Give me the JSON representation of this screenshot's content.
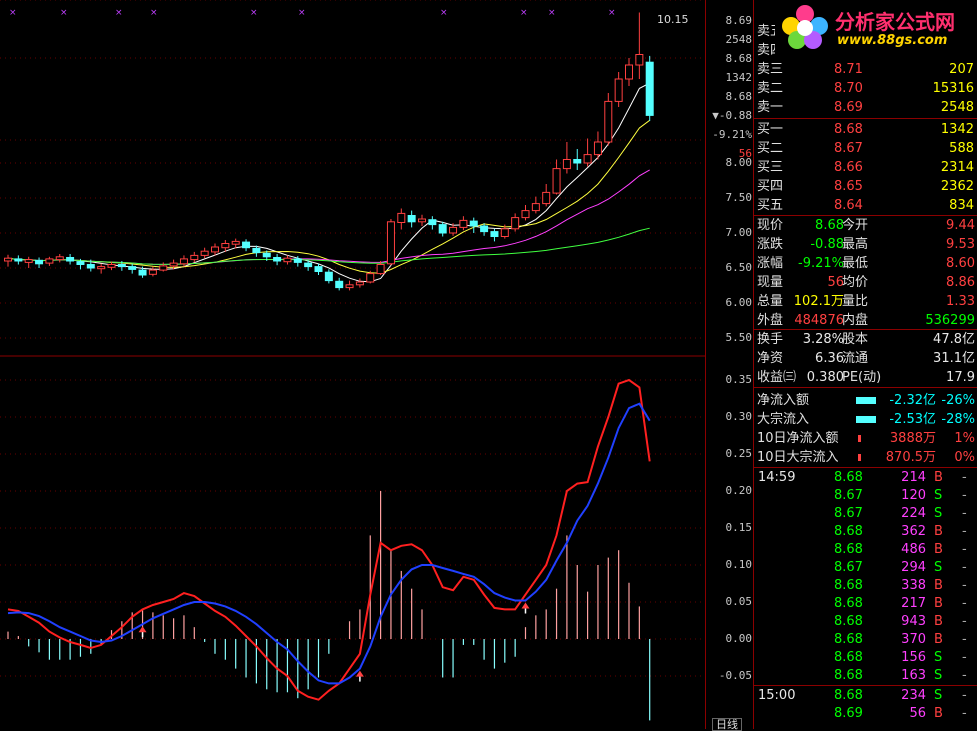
{
  "colors": {
    "up": "#ff4040",
    "down": "#54ffff",
    "ma5": "#ffffff",
    "ma10": "#ffff40",
    "ma20": "#ff40ff",
    "ma60": "#40ff40",
    "dif": "#ff2020",
    "dea": "#2040ff"
  },
  "logo": {
    "text": "分析家公式网",
    "url": "www.88gs.com"
  },
  "price_axis": {
    "top": [
      {
        "v": "8.69",
        "cls": "w"
      },
      {
        "v": "2548",
        "cls": "w"
      },
      {
        "v": "8.68",
        "cls": "w"
      },
      {
        "v": "1342",
        "cls": "w"
      },
      {
        "v": "8.68",
        "cls": "w"
      },
      {
        "v": "▼-0.88",
        "cls": "w"
      },
      {
        "v": "-9.21%",
        "cls": "w"
      },
      {
        "v": "56",
        "cls": "r"
      }
    ],
    "ticks": [
      "8.00",
      "7.50",
      "7.00",
      "6.50",
      "6.00",
      "5.50"
    ]
  },
  "macd_axis": {
    "ticks": [
      "0.35",
      "0.30",
      "0.25",
      "0.20",
      "0.15",
      "0.10",
      "0.05",
      "0.00",
      "-0.05"
    ]
  },
  "chart_labels": {
    "high_mark": "10.15",
    "bottom_right": "日线"
  },
  "order_book": {
    "sell": [
      {
        "label": "卖五",
        "price": "",
        "vol": ""
      },
      {
        "label": "卖四",
        "price": "",
        "vol": ""
      },
      {
        "label": "卖三",
        "price": "8.71",
        "vol": "207"
      },
      {
        "label": "卖二",
        "price": "8.70",
        "vol": "15316"
      },
      {
        "label": "卖一",
        "price": "8.69",
        "vol": "2548"
      }
    ],
    "buy": [
      {
        "label": "买一",
        "price": "8.68",
        "vol": "1342"
      },
      {
        "label": "买二",
        "price": "8.67",
        "vol": "588"
      },
      {
        "label": "买三",
        "price": "8.66",
        "vol": "2314"
      },
      {
        "label": "买四",
        "price": "8.65",
        "vol": "2362"
      },
      {
        "label": "买五",
        "price": "8.64",
        "vol": "834"
      }
    ]
  },
  "quote": [
    {
      "l1": "现价",
      "v1": "8.68",
      "c1": "g",
      "l2": "今开",
      "v2": "9.44",
      "c2": "r"
    },
    {
      "l1": "涨跌",
      "v1": "-0.88",
      "c1": "g",
      "l2": "最高",
      "v2": "9.53",
      "c2": "r"
    },
    {
      "l1": "涨幅",
      "v1": "-9.21%",
      "c1": "g",
      "l2": "最低",
      "v2": "8.60",
      "c2": "r"
    },
    {
      "l1": "现量",
      "v1": "56",
      "c1": "r",
      "l2": "均价",
      "v2": "8.86",
      "c2": "r"
    },
    {
      "l1": "总量",
      "v1": "102.1万",
      "c1": "y",
      "l2": "量比",
      "v2": "1.33",
      "c2": "r"
    },
    {
      "l1": "外盘",
      "v1": "484876",
      "c1": "r",
      "l2": "内盘",
      "v2": "536299",
      "c2": "g"
    },
    {
      "l1": "换手",
      "v1": "3.28%",
      "c1": "w",
      "l2": "股本",
      "v2": "47.8亿",
      "c2": "w"
    },
    {
      "l1": "净资",
      "v1": "6.36",
      "c1": "w",
      "l2": "流通",
      "v2": "31.1亿",
      "c2": "w"
    },
    {
      "l1": "收益㈢",
      "v1": "0.380",
      "c1": "w",
      "l2": "PE(动)",
      "v2": "17.9",
      "c2": "w"
    }
  ],
  "flows": [
    {
      "label": "净流入额",
      "val": "-2.32亿",
      "pct": "-26%",
      "cls": "c",
      "bar": "#54ffff"
    },
    {
      "label": "大宗流入",
      "val": "-2.53亿",
      "pct": "-28%",
      "cls": "c",
      "bar": "#54ffff"
    },
    {
      "label": "10日净流入额",
      "val": "3888万",
      "pct": "1%",
      "cls": "r",
      "bar": "#ff4040"
    },
    {
      "label": "10日大宗流入",
      "val": "870.5万",
      "pct": "0%",
      "cls": "r",
      "bar": "#ff4040"
    }
  ],
  "ticks_list": [
    {
      "time": "14:59",
      "price": "8.68",
      "vol": "214",
      "bs": "B"
    },
    {
      "time": "",
      "price": "8.67",
      "vol": "120",
      "bs": "S"
    },
    {
      "time": "",
      "price": "8.67",
      "vol": "224",
      "bs": "S"
    },
    {
      "time": "",
      "price": "8.68",
      "vol": "362",
      "bs": "B"
    },
    {
      "time": "",
      "price": "8.68",
      "vol": "486",
      "bs": "B"
    },
    {
      "time": "",
      "price": "8.67",
      "vol": "294",
      "bs": "S"
    },
    {
      "time": "",
      "price": "8.68",
      "vol": "338",
      "bs": "B"
    },
    {
      "time": "",
      "price": "8.68",
      "vol": "217",
      "bs": "B"
    },
    {
      "time": "",
      "price": "8.68",
      "vol": "943",
      "bs": "B"
    },
    {
      "time": "",
      "price": "8.68",
      "vol": "370",
      "bs": "B"
    },
    {
      "time": "",
      "price": "8.68",
      "vol": "156",
      "bs": "S"
    },
    {
      "time": "",
      "price": "8.68",
      "vol": "163",
      "bs": "S"
    },
    {
      "time": "15:00",
      "price": "8.68",
      "vol": "234",
      "bs": "S"
    },
    {
      "time": "",
      "price": "8.69",
      "vol": "56",
      "bs": "B"
    }
  ],
  "candles": [
    [
      6.6,
      6.64,
      6.52,
      6.69
    ],
    [
      6.63,
      6.6,
      6.55,
      6.68
    ],
    [
      6.58,
      6.62,
      6.5,
      6.66
    ],
    [
      6.61,
      6.56,
      6.5,
      6.65
    ],
    [
      6.57,
      6.63,
      6.53,
      6.66
    ],
    [
      6.62,
      6.66,
      6.58,
      6.7
    ],
    [
      6.65,
      6.6,
      6.55,
      6.7
    ],
    [
      6.59,
      6.55,
      6.48,
      6.63
    ],
    [
      6.55,
      6.5,
      6.45,
      6.62
    ],
    [
      6.49,
      6.52,
      6.42,
      6.56
    ],
    [
      6.51,
      6.55,
      6.47,
      6.59
    ],
    [
      6.55,
      6.52,
      6.46,
      6.6
    ],
    [
      6.52,
      6.48,
      6.42,
      6.56
    ],
    [
      6.47,
      6.4,
      6.36,
      6.52
    ],
    [
      6.41,
      6.47,
      6.38,
      6.52
    ],
    [
      6.47,
      6.53,
      6.45,
      6.58
    ],
    [
      6.53,
      6.57,
      6.48,
      6.62
    ],
    [
      6.56,
      6.63,
      6.52,
      6.68
    ],
    [
      6.62,
      6.68,
      6.58,
      6.73
    ],
    [
      6.68,
      6.74,
      6.64,
      6.79
    ],
    [
      6.73,
      6.8,
      6.68,
      6.85
    ],
    [
      6.79,
      6.85,
      6.73,
      6.9
    ],
    [
      6.84,
      6.88,
      6.78,
      6.92
    ],
    [
      6.87,
      6.79,
      6.74,
      6.91
    ],
    [
      6.78,
      6.72,
      6.66,
      6.82
    ],
    [
      6.71,
      6.66,
      6.6,
      6.75
    ],
    [
      6.65,
      6.6,
      6.54,
      6.7
    ],
    [
      6.59,
      6.64,
      6.55,
      6.68
    ],
    [
      6.63,
      6.58,
      6.52,
      6.67
    ],
    [
      6.57,
      6.52,
      6.46,
      6.61
    ],
    [
      6.52,
      6.45,
      6.4,
      6.56
    ],
    [
      6.44,
      6.32,
      6.28,
      6.48
    ],
    [
      6.31,
      6.22,
      6.18,
      6.36
    ],
    [
      6.22,
      6.26,
      6.18,
      6.32
    ],
    [
      6.26,
      6.3,
      6.22,
      6.35
    ],
    [
      6.3,
      6.42,
      6.28,
      6.46
    ],
    [
      6.42,
      6.55,
      6.4,
      6.6
    ],
    [
      6.56,
      7.16,
      6.54,
      7.2
    ],
    [
      7.15,
      7.28,
      7.05,
      7.35
    ],
    [
      7.25,
      7.16,
      7.08,
      7.32
    ],
    [
      7.16,
      7.2,
      7.1,
      7.26
    ],
    [
      7.19,
      7.12,
      7.05,
      7.24
    ],
    [
      7.12,
      7.0,
      6.95,
      7.16
    ],
    [
      7.0,
      7.08,
      6.96,
      7.14
    ],
    [
      7.08,
      7.18,
      7.04,
      7.24
    ],
    [
      7.17,
      7.1,
      7.0,
      7.22
    ],
    [
      7.1,
      7.02,
      6.96,
      7.14
    ],
    [
      7.02,
      6.95,
      6.88,
      7.06
    ],
    [
      6.95,
      7.06,
      6.92,
      7.12
    ],
    [
      7.06,
      7.22,
      7.02,
      7.28
    ],
    [
      7.22,
      7.32,
      7.18,
      7.4
    ],
    [
      7.32,
      7.42,
      7.28,
      7.52
    ],
    [
      7.42,
      7.58,
      7.38,
      7.7
    ],
    [
      7.57,
      7.92,
      7.55,
      8.05
    ],
    [
      7.92,
      8.05,
      7.85,
      8.3
    ],
    [
      8.05,
      8.0,
      7.9,
      8.2
    ],
    [
      8.0,
      8.12,
      7.95,
      8.35
    ],
    [
      8.12,
      8.3,
      8.05,
      8.45
    ],
    [
      8.3,
      8.88,
      8.25,
      9.0
    ],
    [
      8.88,
      9.2,
      8.8,
      9.3
    ],
    [
      9.2,
      9.4,
      9.1,
      9.5
    ],
    [
      9.4,
      9.55,
      9.2,
      10.15
    ],
    [
      9.44,
      8.68,
      8.6,
      9.53
    ]
  ],
  "macd": [
    [
      0.04,
      0.035
    ],
    [
      0.038,
      0.036
    ],
    [
      0.03,
      0.035
    ],
    [
      0.022,
      0.031
    ],
    [
      0.01,
      0.024
    ],
    [
      0.002,
      0.016
    ],
    [
      -0.004,
      0.01
    ],
    [
      -0.008,
      0.004
    ],
    [
      -0.012,
      -0.002
    ],
    [
      -0.008,
      -0.004
    ],
    [
      0.004,
      -0.002
    ],
    [
      0.016,
      0.004
    ],
    [
      0.03,
      0.012
    ],
    [
      0.04,
      0.02
    ],
    [
      0.046,
      0.028
    ],
    [
      0.05,
      0.034
    ],
    [
      0.054,
      0.04
    ],
    [
      0.062,
      0.046
    ],
    [
      0.058,
      0.05
    ],
    [
      0.048,
      0.05
    ],
    [
      0.038,
      0.048
    ],
    [
      0.03,
      0.044
    ],
    [
      0.018,
      0.038
    ],
    [
      0.004,
      0.03
    ],
    [
      -0.01,
      0.02
    ],
    [
      -0.026,
      0.008
    ],
    [
      -0.04,
      -0.004
    ],
    [
      -0.05,
      -0.014
    ],
    [
      -0.07,
      -0.03
    ],
    [
      -0.078,
      -0.044
    ],
    [
      -0.082,
      -0.056
    ],
    [
      -0.07,
      -0.06
    ],
    [
      -0.06,
      -0.06
    ],
    [
      -0.04,
      -0.052
    ],
    [
      -0.02,
      -0.04
    ],
    [
      0.06,
      -0.01
    ],
    [
      0.13,
      0.03
    ],
    [
      0.12,
      0.06
    ],
    [
      0.126,
      0.08
    ],
    [
      0.128,
      0.094
    ],
    [
      0.12,
      0.1
    ],
    [
      0.1,
      0.1
    ],
    [
      0.07,
      0.096
    ],
    [
      0.066,
      0.092
    ],
    [
      0.084,
      0.088
    ],
    [
      0.08,
      0.084
    ],
    [
      0.06,
      0.074
    ],
    [
      0.042,
      0.062
    ],
    [
      0.04,
      0.056
    ],
    [
      0.04,
      0.052
    ],
    [
      0.06,
      0.052
    ],
    [
      0.08,
      0.064
    ],
    [
      0.1,
      0.08
    ],
    [
      0.14,
      0.106
    ],
    [
      0.2,
      0.13
    ],
    [
      0.21,
      0.16
    ],
    [
      0.212,
      0.18
    ],
    [
      0.26,
      0.21
    ],
    [
      0.3,
      0.245
    ],
    [
      0.345,
      0.285
    ],
    [
      0.35,
      0.312
    ],
    [
      0.34,
      0.318
    ],
    [
      0.24,
      0.295
    ]
  ]
}
